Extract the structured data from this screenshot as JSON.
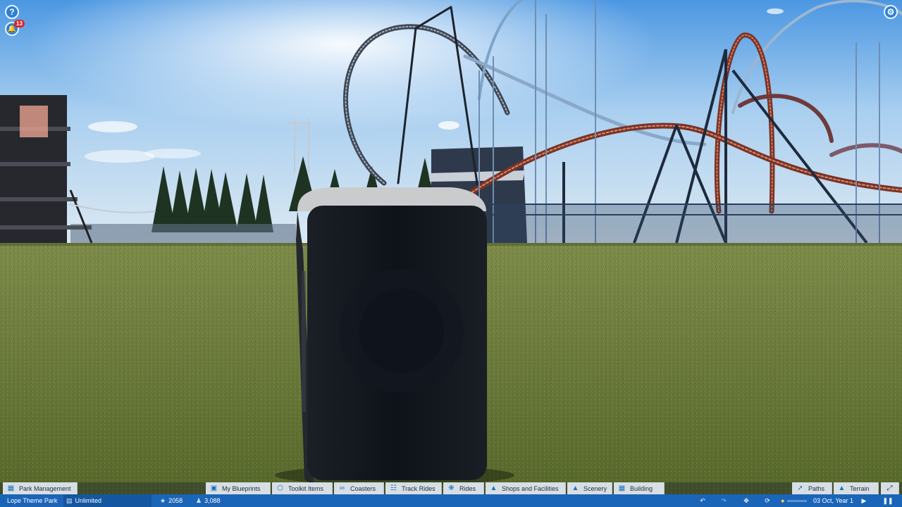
{
  "hud": {
    "help_label": "?",
    "notifications_count": "13",
    "settings_label": "⚙"
  },
  "toolbar": {
    "park_management": "Park Management",
    "my_blueprints": "My Blueprints",
    "toolkit_items": "Toolkit Items",
    "coasters": "Coasters",
    "track_rides": "Track Rides",
    "rides": "Rides",
    "shops_facilities": "Shops and Facilities",
    "scenery": "Scenery",
    "building": "Building",
    "paths": "Paths",
    "terrain": "Terrain"
  },
  "status": {
    "park_name": "Lope Theme Park",
    "money": "Unlimited",
    "rating": "2058",
    "guests": "3,088",
    "date": "03 Oct, Year 1"
  },
  "colors": {
    "sky_top": "#3f8fe0",
    "grass": "#6f7f3a",
    "status_bar": "#1b65b8",
    "coaster_red": "#a5412e",
    "coaster_blue": "#2a4e7a"
  }
}
